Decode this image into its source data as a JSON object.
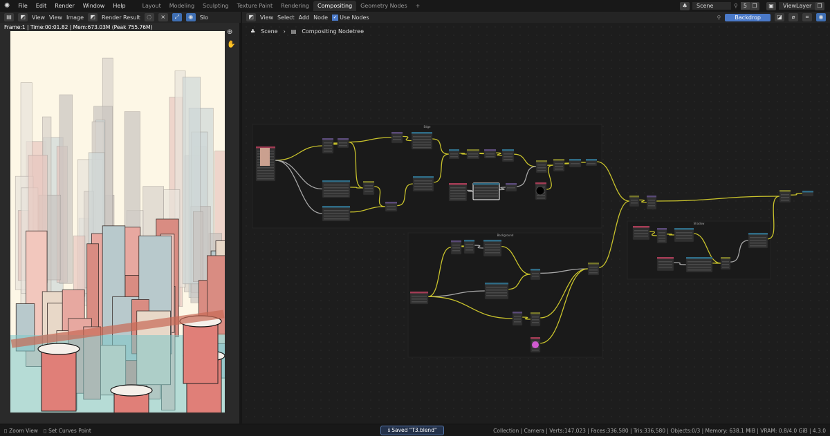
{
  "menu": [
    "File",
    "Edit",
    "Render",
    "Window",
    "Help"
  ],
  "workspaces": [
    "Layout",
    "Modeling",
    "Sculpting",
    "Texture Paint",
    "Rendering",
    "Compositing",
    "Geometry Nodes"
  ],
  "active_workspace": "Compositing",
  "scene": {
    "name": "Scene",
    "users": "5"
  },
  "view_layer": "ViewLayer",
  "image_editor": {
    "view1": "View",
    "view2": "View",
    "image": "Image",
    "image_name": "Render Result",
    "slot": "Slo",
    "frame_info": "Frame:1 | Time:00:01.82 | Mem:673.03M (Peak 755.76M)"
  },
  "node_editor": {
    "view": "View",
    "select": "Select",
    "add": "Add",
    "node": "Node",
    "use_nodes": "Use Nodes",
    "backdrop": "Backdrop",
    "breadcrumb": [
      "Scene",
      "Compositing Nodetree"
    ]
  },
  "frames": [
    "Edge",
    "Background",
    "Shadow"
  ],
  "status": {
    "left1": "Zoom View",
    "left2": "Set Curves Point",
    "saved": "Saved \"T3.blend\"",
    "stats": "Collection | Camera | Verts:147,023 | Faces:336,580 | Tris:336,580 | Objects:0/3 | Memory: 638.1 MiB | VRAM: 0.8/4.0 GiB | 4.3.0"
  }
}
